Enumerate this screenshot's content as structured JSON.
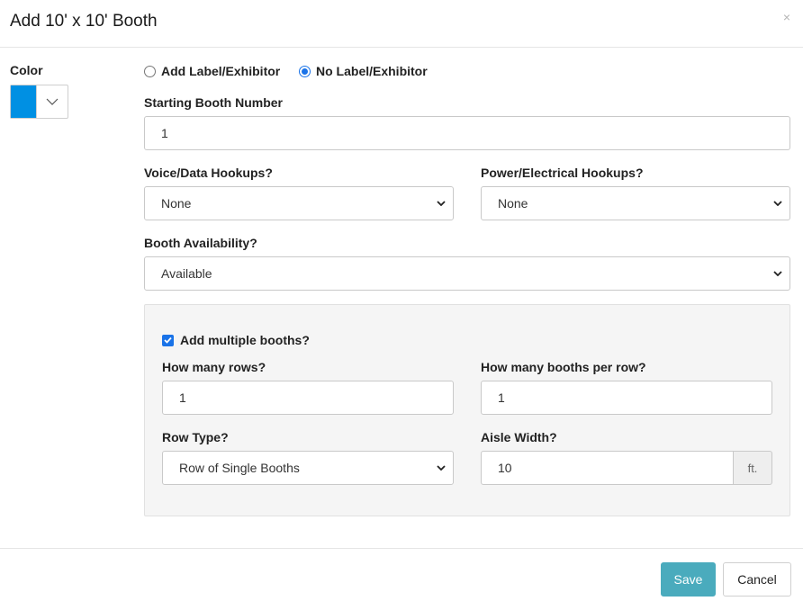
{
  "modal": {
    "title": "Add 10' x 10' Booth",
    "close_symbol": "×"
  },
  "color": {
    "label": "Color",
    "value": "#0090e3"
  },
  "label_mode": {
    "options": [
      "Add Label/Exhibitor",
      "No Label/Exhibitor"
    ],
    "selected_index": 1
  },
  "starting_booth": {
    "label": "Starting Booth Number",
    "value": "1"
  },
  "voice_data": {
    "label": "Voice/Data Hookups?",
    "value": "None"
  },
  "power": {
    "label": "Power/Electrical Hookups?",
    "value": "None"
  },
  "availability": {
    "label": "Booth Availability?",
    "value": "Available"
  },
  "multiple": {
    "label": "Add multiple booths?",
    "checked": true,
    "rows_label": "How many rows?",
    "rows_value": "1",
    "per_row_label": "How many booths per row?",
    "per_row_value": "1",
    "row_type_label": "Row Type?",
    "row_type_value": "Row of Single Booths",
    "aisle_label": "Aisle Width?",
    "aisle_value": "10",
    "aisle_unit": "ft."
  },
  "footer": {
    "save_label": "Save",
    "cancel_label": "Cancel"
  },
  "colors": {
    "accent": "#1a73e8",
    "save_button": "#4aabbd",
    "panel_bg": "#f5f5f5"
  }
}
